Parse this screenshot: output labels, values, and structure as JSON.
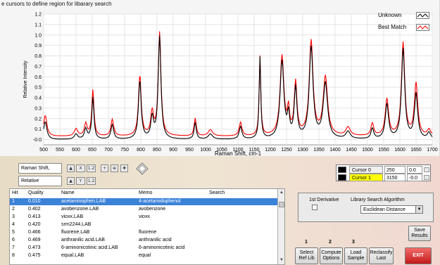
{
  "instruction": "e cursors to define region for libarary search",
  "legend": {
    "unknown_label": "Unknown",
    "best_label": "Best Match"
  },
  "colors": {
    "unknown": "#000000",
    "best": "#ff0000",
    "selection": "#3b82d8",
    "cursor1_highlight": "#ffff00",
    "exit": "#d32a2a"
  },
  "chart_data": {
    "type": "line",
    "title": "",
    "xlabel": "Raman Shift, cm-1",
    "ylabel": "Relative Intensity",
    "xlim": [
      500,
      1700
    ],
    "ylim": [
      -0.05,
      1.2
    ],
    "x_ticks": [
      500,
      550,
      600,
      650,
      700,
      750,
      800,
      850,
      900,
      950,
      1000,
      1050,
      1100,
      1150,
      1200,
      1250,
      1300,
      1350,
      1400,
      1450,
      1500,
      1550,
      1600,
      1650,
      1700
    ],
    "y_ticks": [
      "-0.0",
      "0.1",
      "0.2",
      "0.3",
      "0.4",
      "0.5",
      "0.6",
      "0.7",
      "0.8",
      "0.9",
      "1.0",
      "1.1",
      "1.2"
    ],
    "grid": true,
    "legend_position": "top-right",
    "series": [
      {
        "name": "Unknown",
        "color": "#000000",
        "baseline": 0.0,
        "peaks": [
          [
            505,
            0.17,
            6
          ],
          [
            600,
            0.05,
            6
          ],
          [
            630,
            0.1,
            5
          ],
          [
            652,
            0.4,
            4
          ],
          [
            712,
            0.14,
            5
          ],
          [
            797,
            0.56,
            5
          ],
          [
            835,
            0.2,
            5
          ],
          [
            858,
            0.98,
            5
          ],
          [
            968,
            0.16,
            4
          ],
          [
            1015,
            0.05,
            8
          ],
          [
            1108,
            0.12,
            5
          ],
          [
            1168,
            0.78,
            3
          ],
          [
            1236,
            0.74,
            7
          ],
          [
            1256,
            0.2,
            4
          ],
          [
            1278,
            0.48,
            5
          ],
          [
            1326,
            0.87,
            7
          ],
          [
            1370,
            0.53,
            8
          ],
          [
            1440,
            0.07,
            8
          ],
          [
            1515,
            0.1,
            5
          ],
          [
            1560,
            0.33,
            6
          ],
          [
            1610,
            0.86,
            6
          ],
          [
            1650,
            0.43,
            6
          ],
          [
            1690,
            0.06,
            6
          ]
        ]
      },
      {
        "name": "Best Match",
        "color": "#ff0000",
        "baseline": 0.03,
        "peaks": [
          [
            505,
            0.2,
            6
          ],
          [
            600,
            0.07,
            6
          ],
          [
            630,
            0.12,
            5
          ],
          [
            652,
            0.44,
            4
          ],
          [
            712,
            0.16,
            5
          ],
          [
            797,
            0.58,
            5
          ],
          [
            835,
            0.22,
            5
          ],
          [
            858,
            0.99,
            5
          ],
          [
            968,
            0.17,
            4
          ],
          [
            1015,
            0.06,
            8
          ],
          [
            1108,
            0.13,
            5
          ],
          [
            1168,
            0.76,
            3
          ],
          [
            1236,
            0.76,
            7
          ],
          [
            1256,
            0.22,
            4
          ],
          [
            1278,
            0.5,
            5
          ],
          [
            1326,
            0.9,
            7
          ],
          [
            1370,
            0.56,
            8
          ],
          [
            1440,
            0.08,
            8
          ],
          [
            1515,
            0.12,
            5
          ],
          [
            1560,
            0.35,
            6
          ],
          [
            1610,
            0.89,
            6
          ],
          [
            1650,
            0.5,
            6
          ],
          [
            1690,
            0.06,
            6
          ]
        ]
      }
    ]
  },
  "controls": {
    "x_scale_label": "Raman Shift,",
    "y_scale_label": "Relative"
  },
  "cursors": [
    {
      "name": "Cursor 0",
      "x": "250",
      "y": "0.0"
    },
    {
      "name": "Cursor 1",
      "x": "3150",
      "y": "-0.0"
    }
  ],
  "table": {
    "headers": {
      "hit": "Hit",
      "quality": "Quality",
      "name": "Name",
      "memo": "Memo",
      "search": "Search"
    },
    "rows": [
      {
        "hit": "1",
        "quality": "0.010",
        "name": "acetaminophen.LAB",
        "memo": "4-acetamidophenol"
      },
      {
        "hit": "2",
        "quality": "0.402",
        "name": "avobenzone.LAB",
        "memo": "avobenzone"
      },
      {
        "hit": "3",
        "quality": "0.413",
        "name": "vioxx.LAB",
        "memo": "vioxx"
      },
      {
        "hit": "4",
        "quality": "0.420",
        "name": "srm2244.LAB",
        "memo": ""
      },
      {
        "hit": "5",
        "quality": "0.466",
        "name": "fluorene.LAB",
        "memo": "fluorene"
      },
      {
        "hit": "6",
        "quality": "0.469",
        "name": "anthranilic acid.LAB",
        "memo": "anthranilic acid"
      },
      {
        "hit": "7",
        "quality": "0.473",
        "name": "6-aminonicotinic acid.LAB",
        "memo": "6-aminonicotinic acid"
      },
      {
        "hit": "8",
        "quality": "0.475",
        "name": "equal.LAB",
        "memo": "equal"
      }
    ]
  },
  "algorithm": {
    "derivative_label": "1st Derivative",
    "algorithm_label": "Library Search Algorithm",
    "selected": "Euclidean Distance",
    "derivative_checked": false
  },
  "buttons": {
    "save": "Save Results",
    "select": {
      "num": "1",
      "label": "Select Ref Lib"
    },
    "compute": {
      "num": "2",
      "label": "Compute Options"
    },
    "load": {
      "num": "3",
      "label": "Load Sample"
    },
    "reclassify": "Reclassify Last",
    "exit": "EXIT"
  }
}
